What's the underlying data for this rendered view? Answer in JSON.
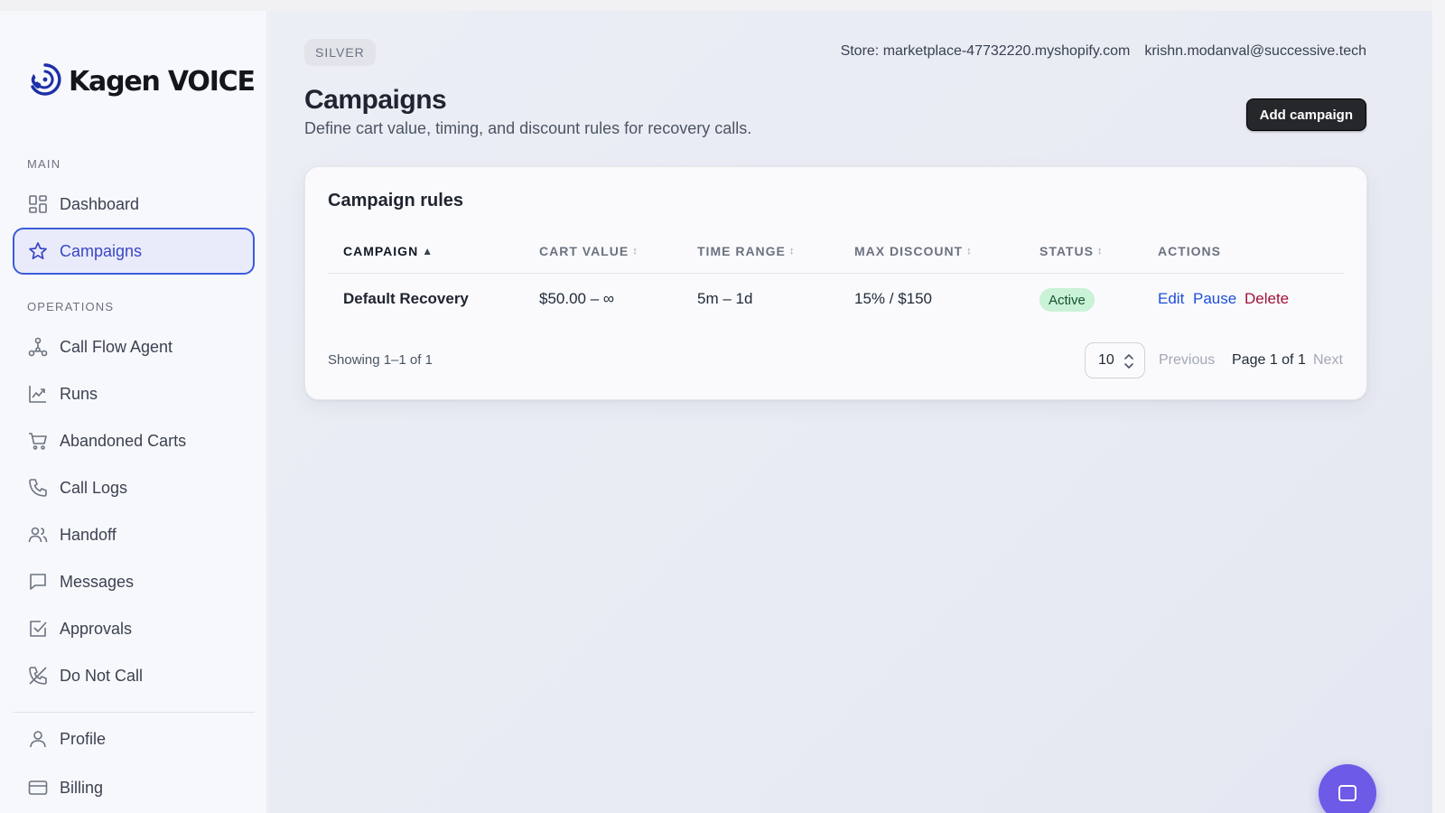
{
  "app": {
    "brand_name": "Kagen VOICE"
  },
  "sidebar": {
    "section_main": "MAIN",
    "section_operations": "OPERATIONS",
    "main_items": [
      {
        "label": "Dashboard",
        "icon": "dashboard-icon"
      },
      {
        "label": "Campaigns",
        "icon": "star-icon",
        "active": true
      }
    ],
    "operation_items": [
      {
        "label": "Call Flow Agent",
        "icon": "flow-icon"
      },
      {
        "label": "Runs",
        "icon": "chart-icon"
      },
      {
        "label": "Abandoned Carts",
        "icon": "cart-icon"
      },
      {
        "label": "Call Logs",
        "icon": "phone-icon"
      },
      {
        "label": "Handoff",
        "icon": "users-icon"
      },
      {
        "label": "Messages",
        "icon": "message-icon"
      },
      {
        "label": "Approvals",
        "icon": "checkbox-icon"
      },
      {
        "label": "Do Not Call",
        "icon": "phone-off-icon"
      }
    ],
    "account_items": [
      {
        "label": "Profile",
        "icon": "user-icon"
      },
      {
        "label": "Billing",
        "icon": "credit-card-icon"
      }
    ],
    "active_color": "#3b5bdb"
  },
  "header": {
    "tier_badge": "SILVER",
    "store": "Store: marketplace-47732220.myshopify.com",
    "email": "krishn.modanval@successive.tech"
  },
  "page": {
    "title": "Campaigns",
    "subtitle": "Define cart value, timing, and discount rules for recovery calls.",
    "add_button": "Add campaign"
  },
  "table": {
    "title": "Campaign rules",
    "columns": [
      {
        "label": "CAMPAIGN",
        "sort": "▲",
        "sorted": true
      },
      {
        "label": "CART VALUE",
        "sort": "↕"
      },
      {
        "label": "TIME RANGE",
        "sort": "↕"
      },
      {
        "label": "MAX DISCOUNT",
        "sort": "↕"
      },
      {
        "label": "STATUS",
        "sort": "↕"
      },
      {
        "label": "ACTIONS",
        "sort": ""
      }
    ],
    "rows": [
      {
        "campaign": "Default Recovery",
        "cart_value": "$50.00 – ∞",
        "time_range": "5m – 1d",
        "max_discount": "15% / $150",
        "status": "Active",
        "actions": {
          "edit": "Edit",
          "pause": "Pause",
          "delete": "Delete"
        }
      }
    ],
    "status_color": "#c9f2d7"
  },
  "pagination": {
    "showing": "Showing 1–1 of 1",
    "page_size": "10",
    "previous": "Previous",
    "page_label": "Page 1 of 1",
    "next": "Next"
  },
  "chat": {
    "icon": "chat-icon",
    "color": "#6d5ae6"
  }
}
